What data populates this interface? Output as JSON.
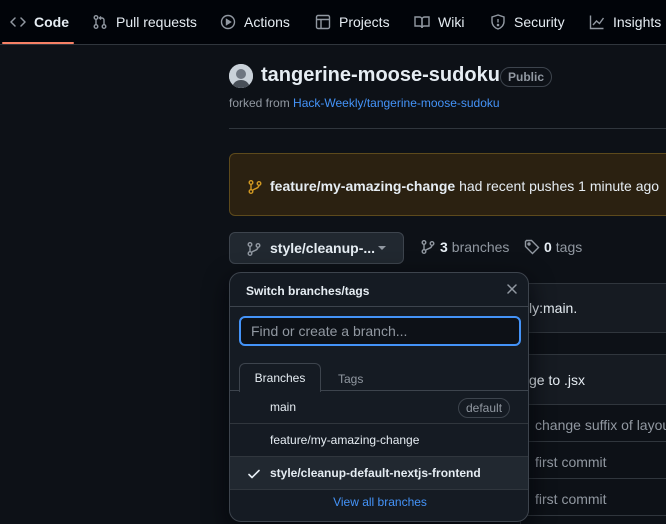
{
  "nav": {
    "tabs": [
      {
        "label": "Code",
        "icon": "code-icon",
        "active": true
      },
      {
        "label": "Pull requests",
        "icon": "git-pull-request-icon"
      },
      {
        "label": "Actions",
        "icon": "play-icon"
      },
      {
        "label": "Projects",
        "icon": "table-icon"
      },
      {
        "label": "Wiki",
        "icon": "book-icon"
      },
      {
        "label": "Security",
        "icon": "shield-icon"
      },
      {
        "label": "Insights",
        "icon": "graph-icon"
      }
    ],
    "active_underline_color": "#f78166"
  },
  "repo": {
    "name": "tangerine-moose-sudoku",
    "visibility": "Public",
    "forked_prefix": "forked from",
    "forked_from": "Hack-Weekly/tangerine-moose-sudoku"
  },
  "banner": {
    "branch": "feature/my-amazing-change",
    "message": "had recent pushes 1 minute ago",
    "icon": "git-branch-icon",
    "accent_color": "#d29922"
  },
  "branch_bar": {
    "current_branch_label": "style/cleanup-...",
    "branches_count": "3",
    "branches_label": "branches",
    "tags_count": "0",
    "tags_label": "tags"
  },
  "background": {
    "fork_status_fragment": "ly:main.",
    "commit_fragment": "ge to .jsx",
    "rows": [
      "change suffix of layou",
      "first commit",
      "first commit"
    ]
  },
  "dropdown": {
    "title": "Switch branches/tags",
    "search_placeholder": "Find or create a branch...",
    "tab_branches": "Branches",
    "tab_tags": "Tags",
    "branches": [
      {
        "name": "main",
        "badge": "default",
        "selected": false
      },
      {
        "name": "feature/my-amazing-change",
        "badge": "",
        "selected": false
      },
      {
        "name": "style/cleanup-default-nextjs-frontend",
        "badge": "",
        "selected": true
      }
    ],
    "view_all": "View all branches"
  }
}
